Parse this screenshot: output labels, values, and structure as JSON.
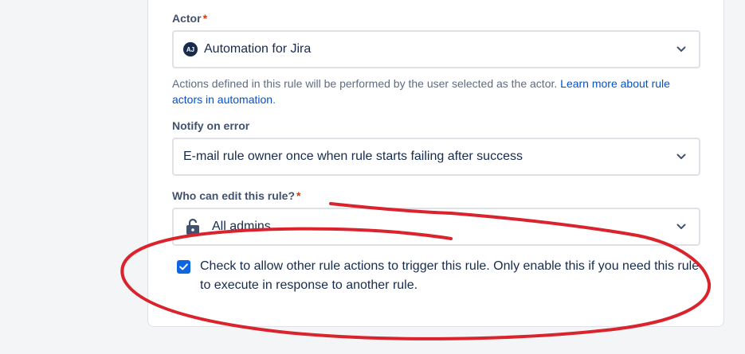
{
  "actor": {
    "label": "Actor",
    "required_mark": "*",
    "avatar_initials": "AJ",
    "value": "Automation for Jira",
    "help_text": "Actions defined in this rule will be performed by the user selected as the actor. ",
    "help_link": "Learn more about rule actors in automation",
    "help_suffix": "."
  },
  "notify": {
    "label": "Notify on error",
    "value": "E-mail rule owner once when rule starts failing after success"
  },
  "editors": {
    "label": "Who can edit this rule?",
    "required_mark": "*",
    "value": "All admins",
    "icon": "unlock-icon"
  },
  "trigger_option": {
    "checked": true,
    "label": "Check to allow other rule actions to trigger this rule. Only enable this if you need this rule to execute in response to another rule."
  },
  "colors": {
    "accent": "#0c66e4",
    "link": "#0052cc",
    "required": "#de350b",
    "annotation": "#d9232d"
  }
}
